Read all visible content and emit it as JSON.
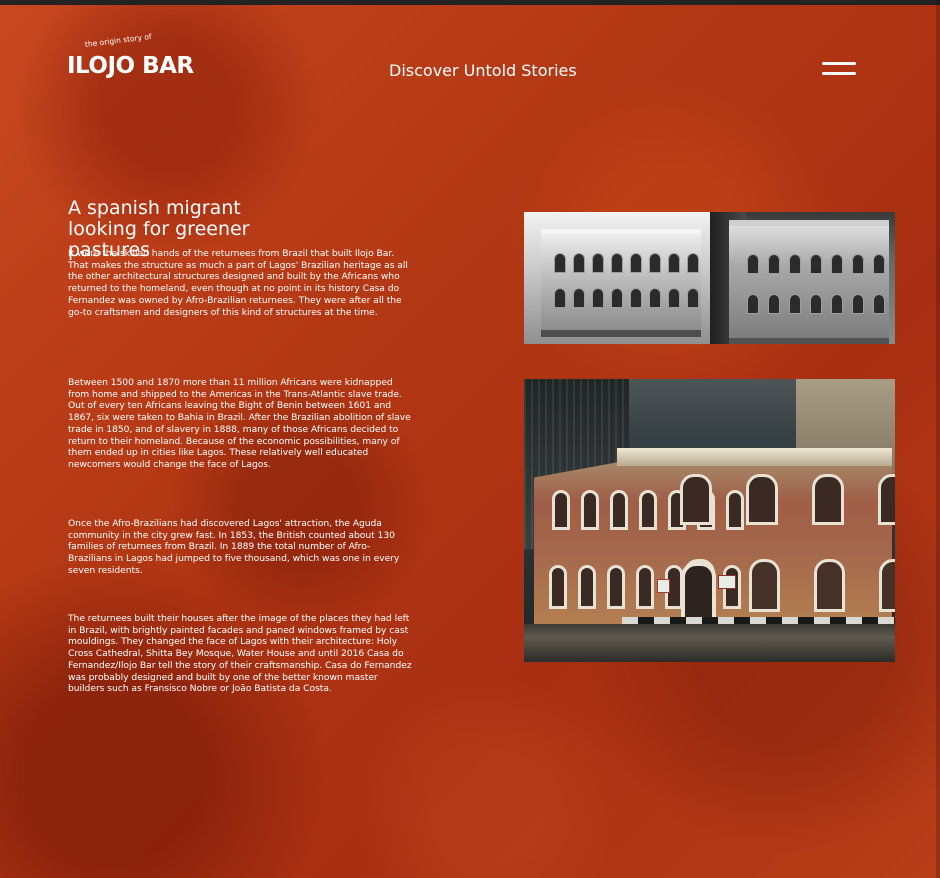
{
  "brand": {
    "tagline": "the origin story of",
    "name": "ILOJO BAR"
  },
  "header": {
    "title": "Discover Untold Stories",
    "menu_icon": "hamburger-menu-icon"
  },
  "article": {
    "title": "A spanish migrant looking for greener pastures",
    "paragraphs": [
      "It were the skilled hands of the returnees from Brazil that built Ilojo Bar. That makes the structure as much a part of Lagos' Brazilian heritage as all the other architectural structures designed and built by the Africans who returned to the homeland, even though at no point in its history Casa do Fernandez was owned by Afro-Brazilian returnees.  They were after all the go-to craftsmen and designers of this kind of structures at the time.",
      "Between 1500 and 1870 more than 11 million Africans were kidnapped from home and shipped to the Americas in the Trans-Atlantic slave trade. Out of every ten Africans leaving the Bight of Benin between 1601 and 1867, six were taken to Bahia in Brazil. After the Brazilian abolition of slave trade in 1850, and of slavery in 1888, many of those Africans decided to return to their homeland. Because of the economic possibilities, many of them ended up in cities like Lagos. These relatively well educated newcomers would change the face of Lagos.",
      "Once the Afro-Brazilians had discovered Lagos' attraction, the Aguda community in the city grew fast. In 1853, the British counted about 130 families of returnees from Brazil. In 1889 the total number of Afro-Brazilians in Lagos had jumped to five thousand, which was one in every seven residents.",
      "The returnees built their houses after the image of the places they had left in Brazil, with brightly painted facades and paned windows framed by cast mouldings. They changed the face of Lagos with their architecture: Holy Cross Cathedral, Shitta Bey Mosque, Water House and until 2016 Casa do Fernandez/Ilojo Bar tell the story of their craftsmanship. Casa do Fernandez was probably designed and built by one of the better known master builders such as Fransisco Nobre or João Batista da Costa."
    ]
  },
  "images": [
    {
      "name": "historic-building-comparison-photo"
    },
    {
      "name": "ilojo-bar-color-photo"
    }
  ],
  "colors": {
    "background": "#b43b17",
    "text": "#ffffff",
    "top_bar": "#232323"
  }
}
